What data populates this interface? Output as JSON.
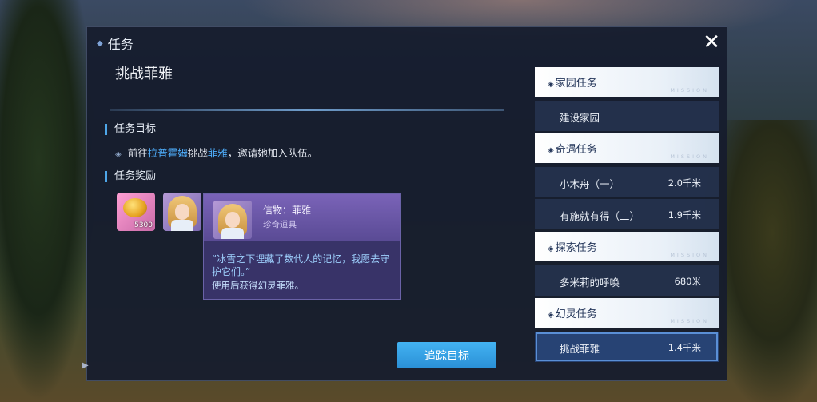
{
  "window": {
    "title": "任务",
    "close_label": "✕"
  },
  "quest": {
    "title": "挑战菲雅",
    "objective_header": "任务目标",
    "objective_parts": [
      "前往",
      "拉普霍姆",
      "挑战",
      "菲雅",
      "，邀请她加入队伍。"
    ],
    "reward_header": "任务奖励",
    "rewards": [
      {
        "icon": "gold-coins-icon",
        "quantity": "5300"
      },
      {
        "icon": "fiya-portrait-icon"
      }
    ],
    "track_button": "追踪目标"
  },
  "tooltip": {
    "name": "信物：菲雅",
    "type": "珍奇道具",
    "quote": "“冰雪之下埋藏了数代人的记忆，我愿去守护它们。”",
    "description": "使用后获得幻灵菲雅。"
  },
  "quest_list": {
    "watermark": "MISSION",
    "categories": [
      {
        "label": "家园任务",
        "items": [
          {
            "name": "建设家园",
            "distance": ""
          }
        ]
      },
      {
        "label": "奇遇任务",
        "items": [
          {
            "name": "小木舟（一）",
            "distance": "2.0千米"
          },
          {
            "name": "有施就有得（二）",
            "distance": "1.9千米"
          }
        ]
      },
      {
        "label": "探索任务",
        "items": [
          {
            "name": "多米莉的呼唤",
            "distance": "680米"
          }
        ]
      },
      {
        "label": "幻灵任务",
        "items": [
          {
            "name": "挑战菲雅",
            "distance": "1.4千米",
            "selected": true
          }
        ]
      }
    ]
  },
  "colors": {
    "accent": "#4ea6e8",
    "highlight_text": "#4fb0ff",
    "button": "#2f9be0",
    "tooltip_bg": "#3a346a"
  }
}
